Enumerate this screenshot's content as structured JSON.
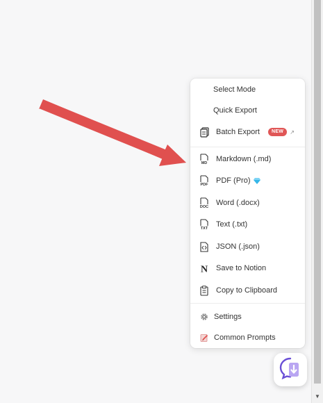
{
  "menu": {
    "items": [
      {
        "label": "Select Mode",
        "icon": null
      },
      {
        "label": "Quick Export",
        "icon": null
      },
      {
        "label": "Batch Export",
        "icon": "batch-export-icon",
        "badge": "NEW"
      },
      {
        "label": "Markdown (.md)",
        "icon": "markdown-file-icon",
        "icon_text": "MD"
      },
      {
        "label": "PDF (Pro)",
        "icon": "pdf-file-icon",
        "icon_text": "PDF"
      },
      {
        "label": "Word (.docx)",
        "icon": "word-file-icon",
        "icon_text": "DOC"
      },
      {
        "label": "Text (.txt)",
        "icon": "text-file-icon",
        "icon_text": "TXT"
      },
      {
        "label": "JSON (.json)",
        "icon": "json-file-icon"
      },
      {
        "label": "Save to Notion",
        "icon": "notion-icon"
      },
      {
        "label": "Copy to Clipboard",
        "icon": "clipboard-icon"
      },
      {
        "label": "Settings",
        "icon": "gear-icon"
      },
      {
        "label": "Common Prompts",
        "icon": "prompts-icon"
      }
    ]
  },
  "colors": {
    "arrow": "#e0504f",
    "badge": "#e05656",
    "fab_accent": "#7a5ae0"
  }
}
